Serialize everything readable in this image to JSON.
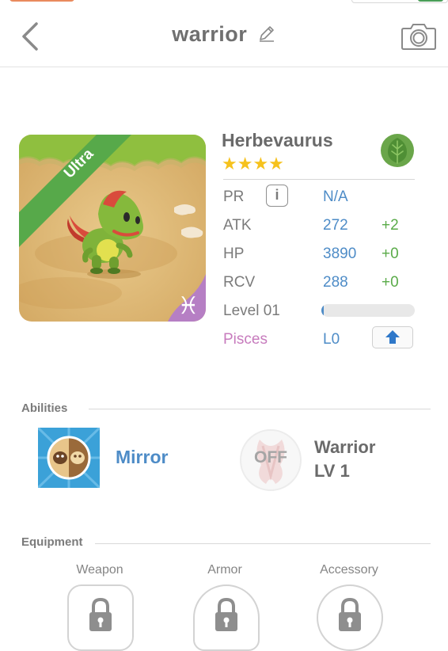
{
  "header": {
    "title": "warrior"
  },
  "monster": {
    "name": "Herbevaurus",
    "rarity": "Ultra",
    "stars": "★★★★",
    "star_count": 4,
    "element_icon": "leaf-icon",
    "zodiac_icon": "pisces-icon"
  },
  "stats": {
    "pr": {
      "label": "PR",
      "value": "N/A"
    },
    "atk": {
      "label": "ATK",
      "value": "272",
      "bonus": "+2"
    },
    "hp": {
      "label": "HP",
      "value": "3890",
      "bonus": "+0"
    },
    "rcv": {
      "label": "RCV",
      "value": "288",
      "bonus": "+0"
    },
    "level": {
      "label": "Level 01",
      "progress": 0.01
    },
    "zodiac": {
      "label": "Pisces",
      "value": "L0"
    }
  },
  "abilities": {
    "title": "Abilities",
    "mirror": {
      "label": "Mirror"
    },
    "warrior": {
      "status": "OFF",
      "name": "Warrior",
      "level": "LV 1"
    }
  },
  "equipment": {
    "title": "Equipment",
    "weapon": "Weapon",
    "armor": "Armor",
    "accessory": "Accessory"
  },
  "colors": {
    "accent_blue": "#4e8cc7",
    "bonus_green": "#5aab49",
    "pisces_pink": "#c77bbd",
    "star_gold": "#f6c21d",
    "banner_green": "#57a94a"
  }
}
